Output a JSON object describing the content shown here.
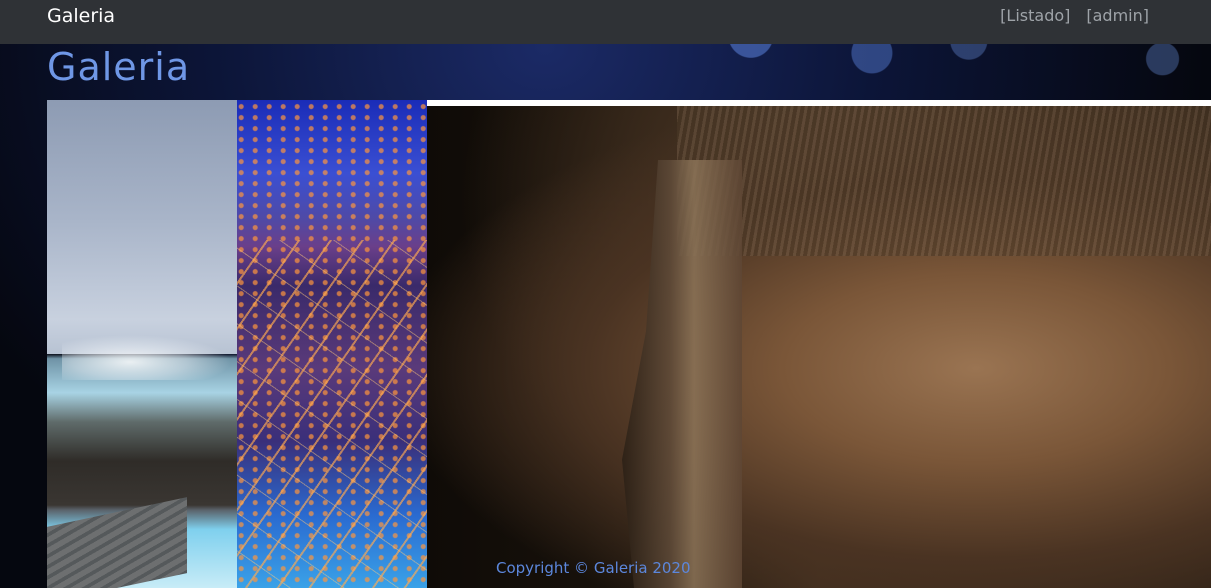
{
  "navbar": {
    "brand": "Galeria",
    "links": [
      "[Listado]",
      "[admin]"
    ]
  },
  "header": {
    "title": "Galeria"
  },
  "gallery": {
    "photos": [
      "lagoon-photo",
      "city-night-photo",
      "cave-photo"
    ]
  },
  "footer": {
    "copyright": "Copyright © Galeria 2020"
  },
  "colors": {
    "navbar_bg": "#2f3236",
    "title": "#6f97e6",
    "footer_text": "#5c87dc"
  }
}
